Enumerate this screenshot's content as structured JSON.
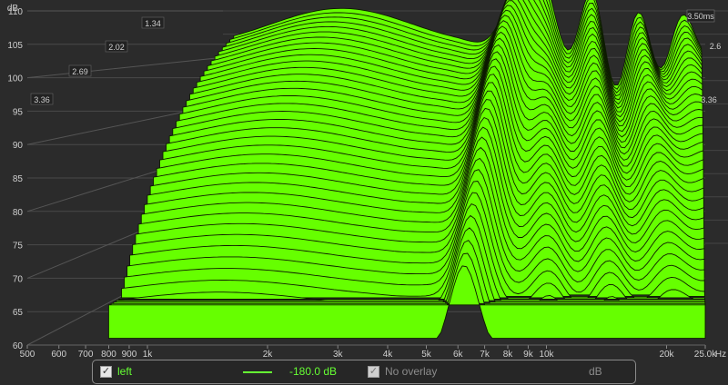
{
  "chart_data": {
    "type": "waterfall-3d",
    "y_axis": {
      "label": "dB",
      "ticks": [
        60,
        65,
        70,
        75,
        80,
        85,
        90,
        95,
        100,
        105,
        110
      ],
      "range": [
        60,
        110
      ]
    },
    "x_axis": {
      "unit": "Hz",
      "scale": "log",
      "range": [
        500,
        25000
      ],
      "ticks": [
        {
          "value": 500,
          "label": "500"
        },
        {
          "value": 600,
          "label": "600"
        },
        {
          "value": 700,
          "label": "700"
        },
        {
          "value": 800,
          "label": "800"
        },
        {
          "value": 900,
          "label": "900"
        },
        {
          "value": 1000,
          "label": "1k"
        },
        {
          "value": 2000,
          "label": "2k"
        },
        {
          "value": 3000,
          "label": "3k"
        },
        {
          "value": 4000,
          "label": "4k"
        },
        {
          "value": 5000,
          "label": "5k"
        },
        {
          "value": 6000,
          "label": "6k"
        },
        {
          "value": 7000,
          "label": "7k"
        },
        {
          "value": 8000,
          "label": "8k"
        },
        {
          "value": 9000,
          "label": "9k"
        },
        {
          "value": 10000,
          "label": "10k"
        },
        {
          "value": 20000,
          "label": "20k"
        },
        {
          "value": 25000,
          "label": "25.0k"
        }
      ]
    },
    "time_axis": {
      "unit": "ms",
      "max_label": "3.50ms",
      "left_ticks": [
        "1.34",
        "2.02",
        "2.69",
        "3.36"
      ],
      "right_ticks": [
        "3.36",
        "2.6"
      ]
    },
    "series": [
      {
        "name": "left",
        "color": "#66ff00",
        "slice_count": 40,
        "peaks": [
          {
            "freq": 1400,
            "db": 102
          },
          {
            "freq": 6200,
            "db": 108
          },
          {
            "freq": 9500,
            "db": 99
          },
          {
            "freq": 21000,
            "db": 98
          }
        ]
      }
    ]
  },
  "legend": {
    "series_label": "left",
    "series_value": "-180.0 dB",
    "overlay_label": "No overlay",
    "unit": "dB",
    "check_mark": "✓"
  },
  "colors": {
    "background": "#2b2b2b",
    "surface": "#66ff00",
    "grid": "#5a5a5a",
    "text": "#d0d0d0"
  }
}
